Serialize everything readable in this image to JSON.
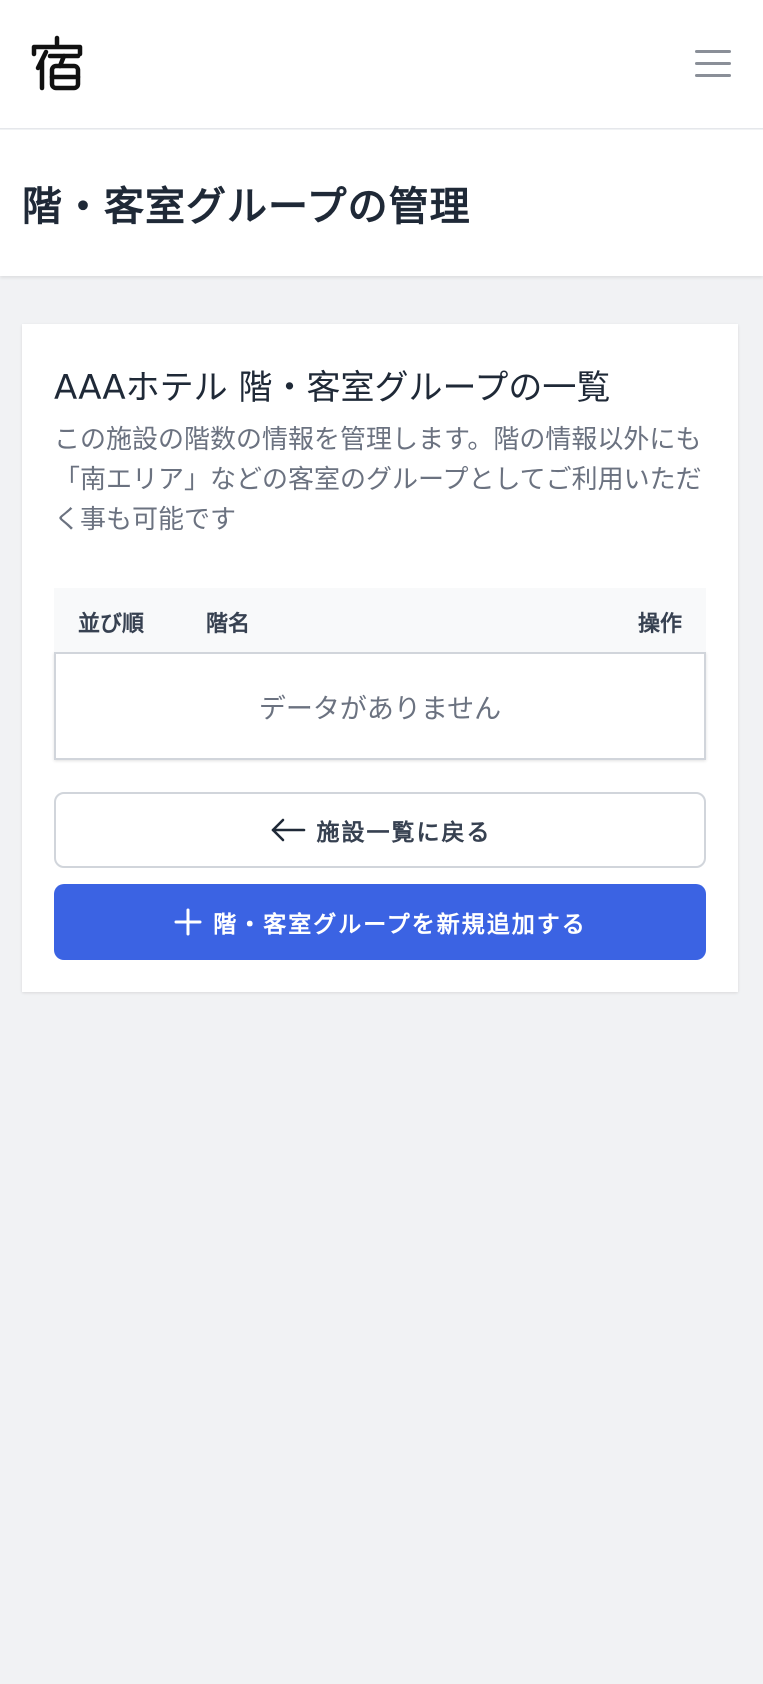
{
  "header": {
    "logo_icon": "inn-kanji-logo-icon",
    "menu_icon": "hamburger-menu-icon"
  },
  "page": {
    "title": "階・客室グループの管理"
  },
  "card": {
    "title": "AAAホテル 階・客室グループの一覧",
    "description": "この施設の階数の情報を管理します。階の情報以外にも「南エリア」などの客室のグループとしてご利用いただく事も可能です"
  },
  "table": {
    "columns": [
      "並び順",
      "階名",
      "操作"
    ],
    "rows": [],
    "empty_message": "データがありません"
  },
  "buttons": {
    "back_label": "施設一覧に戻る",
    "back_icon": "arrow-left-icon",
    "add_label": "階・客室グループを新規追加する",
    "add_icon": "plus-icon"
  },
  "colors": {
    "primary": "#3b63e3",
    "background": "#f1f2f4",
    "text": "#1f2937",
    "muted": "#6b7280"
  }
}
